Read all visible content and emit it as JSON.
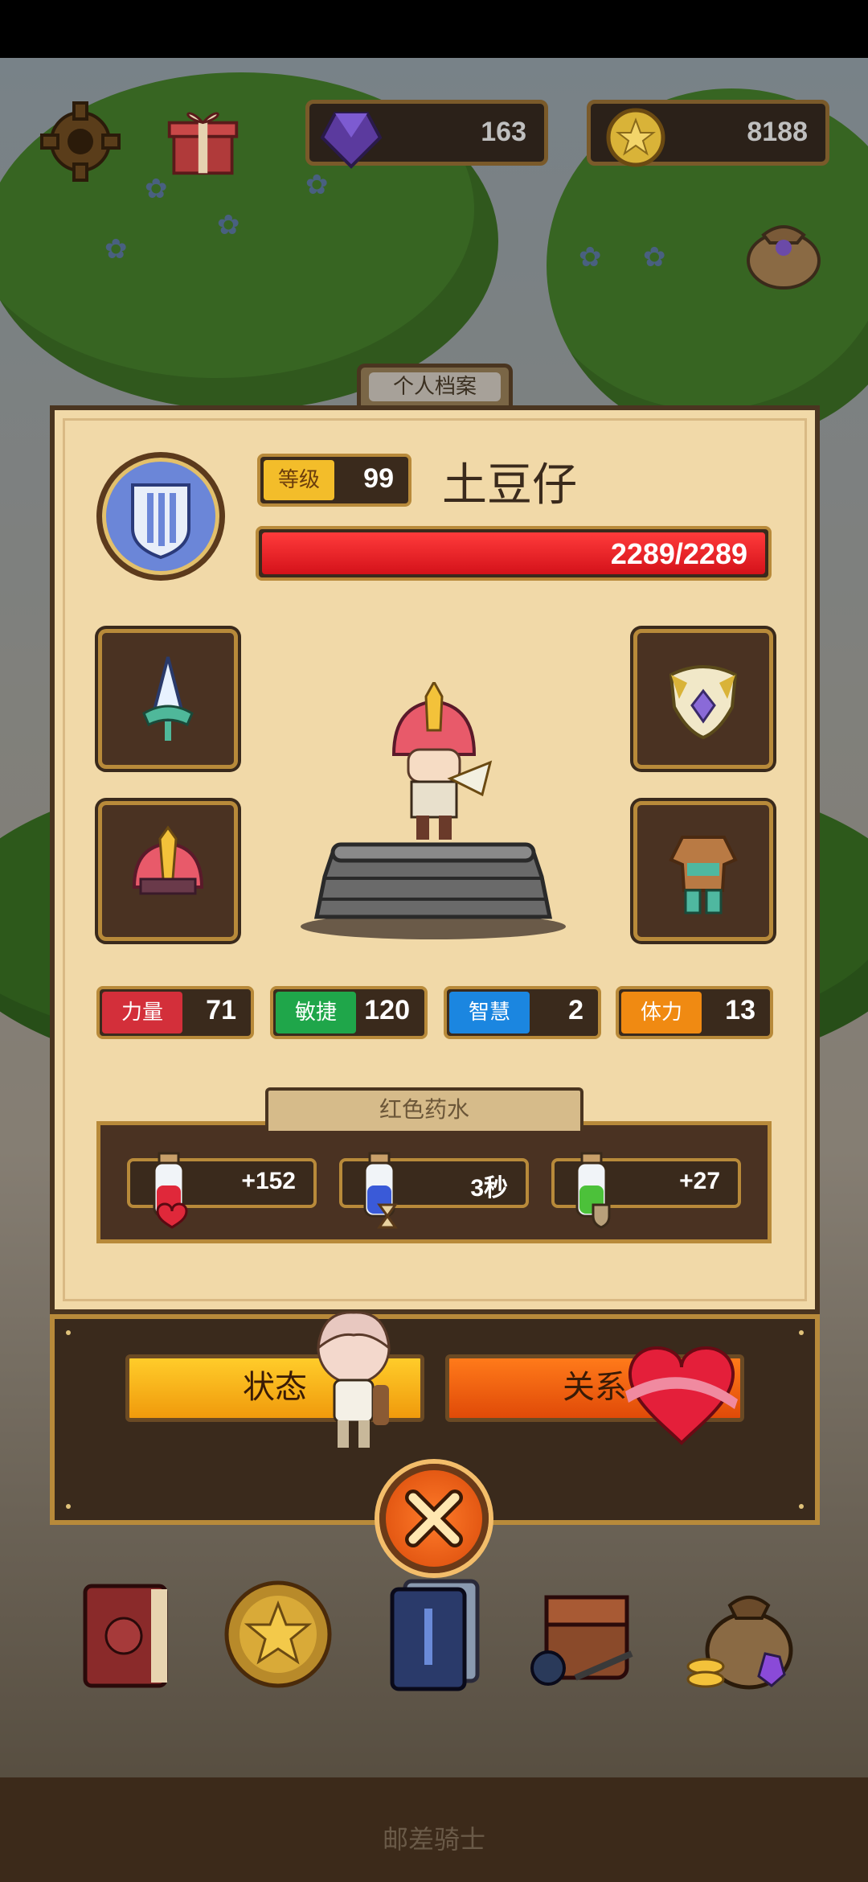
{
  "currency": {
    "gems": "163",
    "coins": "8188"
  },
  "profile": {
    "tab_title": "个人档案",
    "level_label": "等级",
    "level_value": "99",
    "name": "土豆仔",
    "hp_text": "2289/2289",
    "hp_fraction": 1.0
  },
  "stats": [
    {
      "label": "力量",
      "value": "71",
      "color": "#d32f3a"
    },
    {
      "label": "敏捷",
      "value": "120",
      "color": "#1fa64a"
    },
    {
      "label": "智慧",
      "value": "2",
      "color": "#1b86e0"
    },
    {
      "label": "体力",
      "value": "13",
      "color": "#f08a12"
    }
  ],
  "potions": {
    "title": "红色药水",
    "items": [
      {
        "value": "+152",
        "icon": "red-potion-heart-icon"
      },
      {
        "value": "3秒",
        "icon": "blue-potion-hourglass-icon"
      },
      {
        "value": "+27",
        "icon": "green-potion-shield-icon"
      }
    ]
  },
  "buttons": {
    "status": "状态",
    "relation": "关系"
  },
  "footer": {
    "title": "邮差骑士"
  }
}
